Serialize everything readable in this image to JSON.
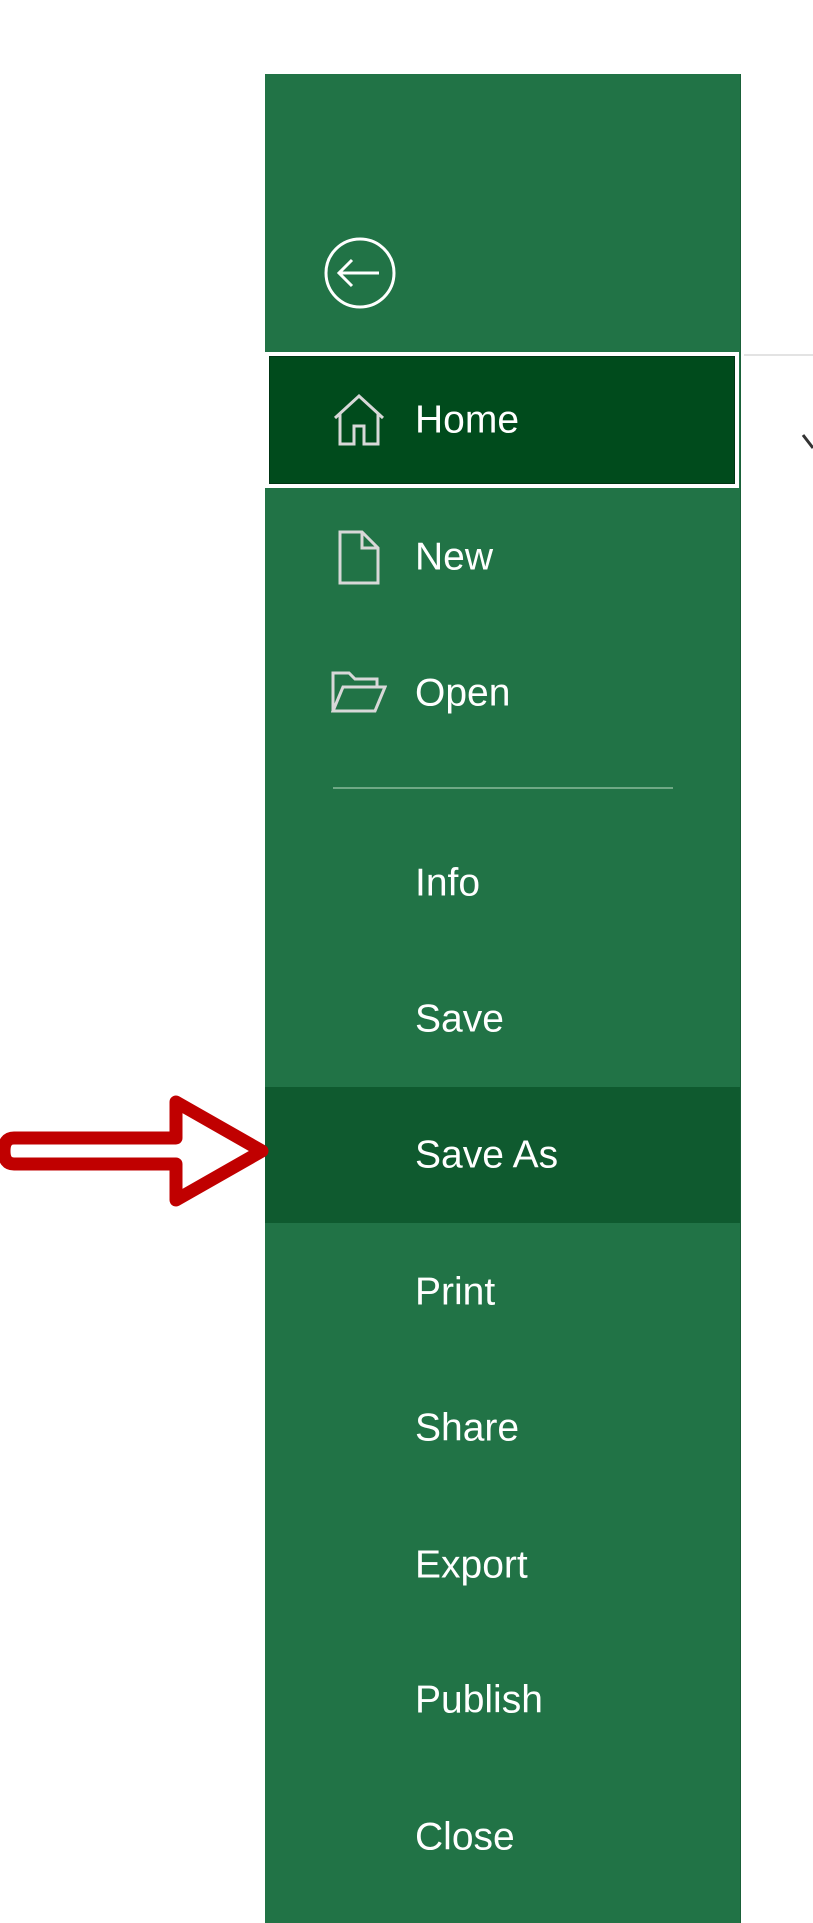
{
  "app": {
    "view": "File backstage",
    "accent_color": "#217346",
    "selected_color": "#004b1c",
    "hover_color": "#0f5a2f"
  },
  "back_button": {
    "icon": "back-arrow-circle-icon"
  },
  "nav": {
    "primary": [
      {
        "label": "Home",
        "icon": "home-icon",
        "state": "selected"
      },
      {
        "label": "New",
        "icon": "new-document-icon",
        "state": "normal"
      },
      {
        "label": "Open",
        "icon": "open-folder-icon",
        "state": "normal"
      }
    ],
    "secondary": [
      {
        "label": "Info",
        "state": "normal"
      },
      {
        "label": "Save",
        "state": "normal"
      },
      {
        "label": "Save As",
        "state": "highlighted"
      },
      {
        "label": "Print",
        "state": "normal"
      },
      {
        "label": "Share",
        "state": "normal"
      },
      {
        "label": "Export",
        "state": "normal"
      },
      {
        "label": "Publish",
        "state": "normal"
      },
      {
        "label": "Close",
        "state": "normal"
      }
    ]
  },
  "annotation": {
    "type": "callout-arrow",
    "points_to": "Save As",
    "color": "#c00000"
  }
}
